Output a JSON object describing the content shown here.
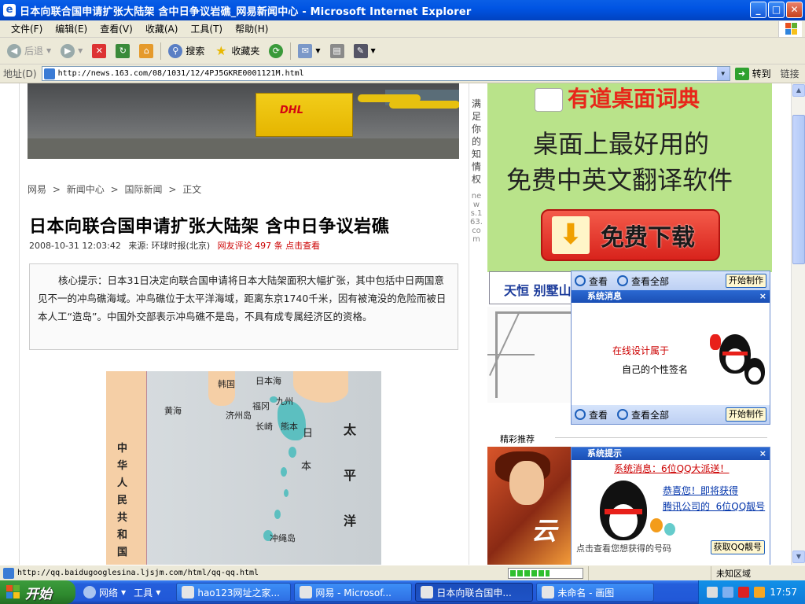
{
  "window": {
    "title": "日本向联合国申请扩张大陆架 含中日争议岩礁_网易新闻中心 - Microsoft Internet Explorer",
    "controls": {
      "minimize": "_",
      "maximize": "□",
      "close": "✕"
    }
  },
  "menu": [
    "文件(F)",
    "编辑(E)",
    "查看(V)",
    "收藏(A)",
    "工具(T)",
    "帮助(H)"
  ],
  "toolbar": {
    "back": "后退",
    "search": "搜索",
    "favorites": "收藏夹"
  },
  "address": {
    "label": "地址(D)",
    "url": "http://news.163.com/08/1031/12/4PJ5GKRE0001121M.html",
    "go": "转到",
    "links": "链接"
  },
  "article": {
    "breadcrumb": [
      "网易",
      "新闻中心",
      "国际新闻",
      "正文"
    ],
    "breadcrumb_sep": ">",
    "headline": "日本向联合国申请扩张大陆架 含中日争议岩礁",
    "datetime": "2008-10-31 12:03:42",
    "source_label": "来源:",
    "source": "环球时报(北京)",
    "comments_label": "网友评论",
    "comments_count": "497",
    "comments_unit": "条",
    "comments_link": "点击查看",
    "summary": "核心提示：日本31日决定向联合国申请将日本大陆架面积大幅扩张，其中包括中日两国意见不一的冲鸟礁海域。冲鸟礁位于太平洋海域，距离东京1740千米，因有被淹没的危险而被日本人工“造岛”。中国外交部表示冲鸟礁不是岛，不具有成专属经济区的资格。",
    "vertical_tagline": "满足你的知情权",
    "vertical_site": "news.163.com"
  },
  "map": {
    "labels": {
      "korea": "韩国",
      "sea_of_japan": "日本海",
      "kyushu": "九州",
      "jeju": "济州岛",
      "fukuoka": "福冈",
      "nagasaki": "长崎",
      "kumamoto": "熊本",
      "yellow_sea": "黄海",
      "japan_1": "日",
      "japan_2": "本",
      "okinawa": "冲绳岛"
    },
    "pacific": "太平洋",
    "china": "中华人民共和国"
  },
  "ads": {
    "youdao_logo": "有道桌面词典",
    "youdao_line1": "桌面上最好用的",
    "youdao_line2": "免费中英文翻译软件",
    "youdao_download": "免费下载",
    "tianheng": "天恒 别墅山",
    "jingcai": "精彩推荐",
    "game_text": "云"
  },
  "popups": {
    "view": "查看",
    "view_all": "查看全部",
    "start_make": "开始制作",
    "sys_msg_title": "系统消息",
    "sys_tip_title": "系统提示",
    "close": "×",
    "online_design": "在线设计属于",
    "own_signature": "自己的个性签名",
    "sys_news": "系统消息：6位QQ大派送！",
    "congrats": "恭喜您！即将获得",
    "tencent": "腾讯公司的  6位QQ靓号",
    "click_view": "点击查看您想获得的号码",
    "get_number": "获取QQ靓号"
  },
  "status": {
    "url": "http://qq.baidugooglesina.ljsjm.com/html/qq-qq.html",
    "progress": 0.55,
    "zone": "未知区域"
  },
  "taskbar": {
    "start": "开始",
    "network": "网络",
    "tools": "工具",
    "tasks": [
      "hao123网址之家...",
      "网易 - Microsof...",
      "日本向联合国申...",
      "未命名 - 画图"
    ],
    "clock": "17:57"
  },
  "colors": {
    "titlebar": "#0054e3",
    "start_green": "#2e8a2e",
    "ad_green": "#b9e38a",
    "link_red": "#cc0000"
  }
}
